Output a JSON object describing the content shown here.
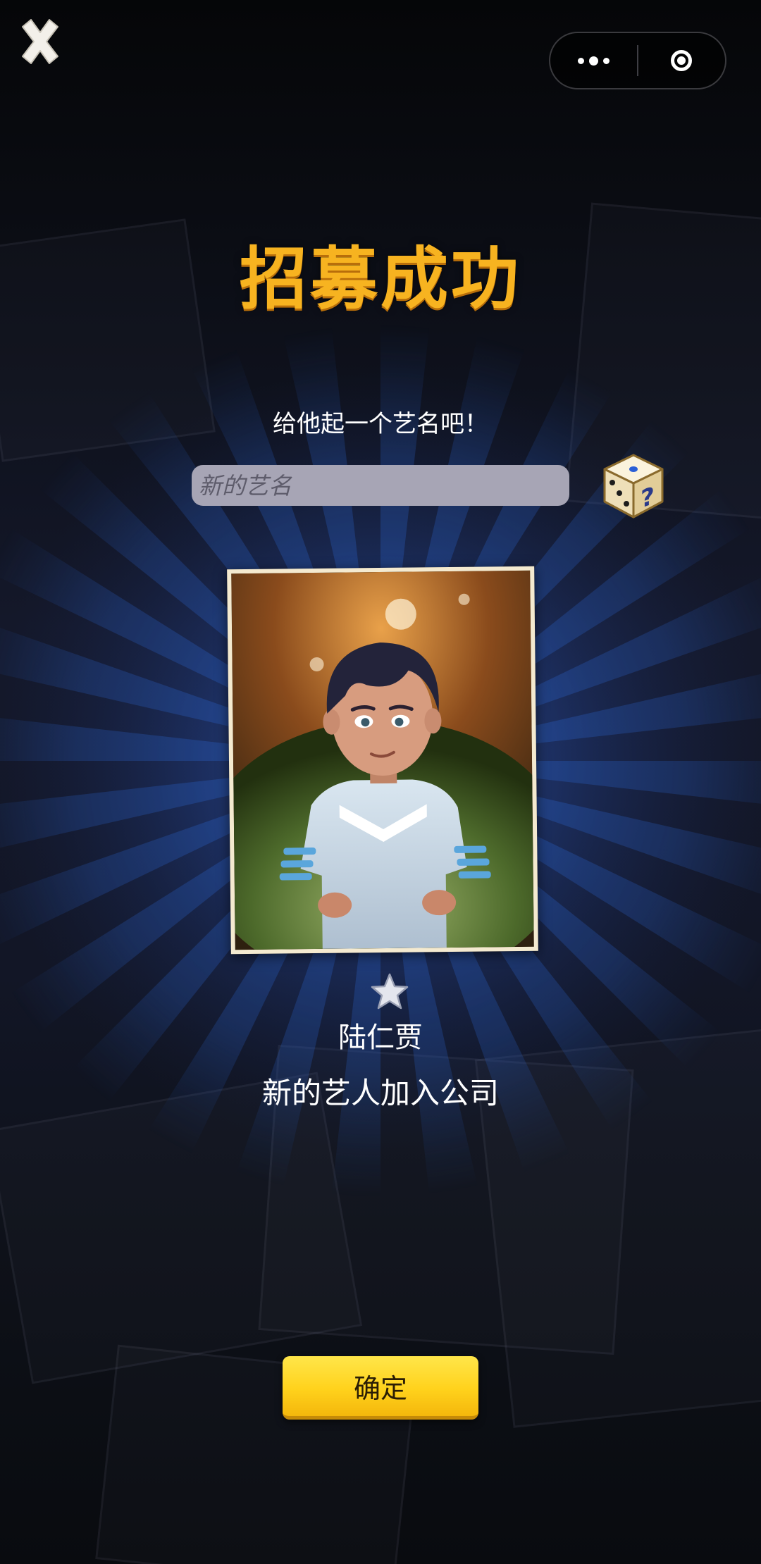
{
  "topbar": {
    "close_icon": "close-x-icon",
    "more_icon": "more-dots-icon",
    "target_icon": "target-circle-icon"
  },
  "dialog": {
    "title": "招募成功",
    "prompt": "给他起一个艺名吧！",
    "name_input": {
      "placeholder": "新的艺名",
      "value": ""
    },
    "dice_icon": "random-dice-icon",
    "portrait": "artist-portrait-image",
    "star_rating": 1,
    "artist_name": "陆仁贾",
    "message": "新的艺人加入公司",
    "confirm_label": "确定"
  },
  "colors": {
    "title": "#f7b320",
    "button": "#ffd21c",
    "rays": "#2b5fc4"
  }
}
